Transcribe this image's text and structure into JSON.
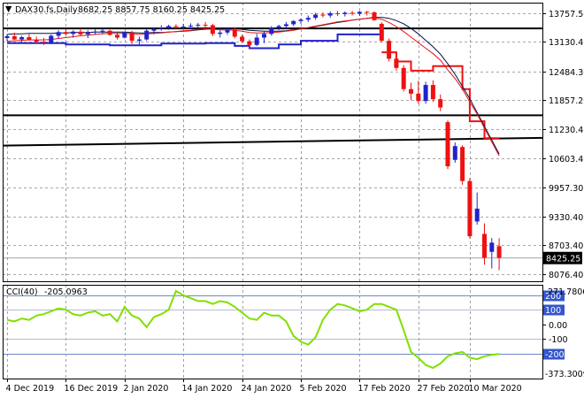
{
  "chart_data": [
    {
      "type": "candlestick",
      "symbol_line": "DAX30.fs,Daily",
      "ohlc_readout": "8682.25 8857.75 8160.25 8425.25",
      "last_price_label": "8425.25",
      "ylim": [
        7920,
        13980
      ],
      "price_ticks": [
        {
          "value": 13757.5,
          "label": "13757.50"
        },
        {
          "value": 13130.4,
          "label": "13130.40"
        },
        {
          "value": 12484.3,
          "label": "12484.30"
        },
        {
          "value": 11857.2,
          "label": "11857.20"
        },
        {
          "value": 11230.4,
          "label": "11230.40"
        },
        {
          "value": 10603.4,
          "label": "10603.40"
        },
        {
          "value": 9957.3,
          "label": "9957.30"
        },
        {
          "value": 9330.4,
          "label": "9330.40"
        },
        {
          "value": 8703.4,
          "label": "8703.40"
        },
        {
          "value": 8076.4,
          "label": "8076.40"
        }
      ],
      "horizontal_levels": [
        13420,
        11530,
        11020
      ],
      "candles": [
        {
          "o": 13210,
          "h": 13290,
          "l": 13140,
          "c": 13250
        },
        {
          "o": 13250,
          "h": 13330,
          "l": 13170,
          "c": 13180
        },
        {
          "o": 13180,
          "h": 13260,
          "l": 13100,
          "c": 13230
        },
        {
          "o": 13230,
          "h": 13300,
          "l": 13150,
          "c": 13170
        },
        {
          "o": 13170,
          "h": 13240,
          "l": 13090,
          "c": 13130
        },
        {
          "o": 13130,
          "h": 13210,
          "l": 13060,
          "c": 13110
        },
        {
          "o": 13110,
          "h": 13290,
          "l": 13080,
          "c": 13260
        },
        {
          "o": 13260,
          "h": 13380,
          "l": 13200,
          "c": 13340
        },
        {
          "o": 13340,
          "h": 13400,
          "l": 13270,
          "c": 13300
        },
        {
          "o": 13300,
          "h": 13380,
          "l": 13220,
          "c": 13350
        },
        {
          "o": 13350,
          "h": 13420,
          "l": 13250,
          "c": 13290
        },
        {
          "o": 13290,
          "h": 13380,
          "l": 13210,
          "c": 13330
        },
        {
          "o": 13330,
          "h": 13400,
          "l": 13280,
          "c": 13350
        },
        {
          "o": 13350,
          "h": 13410,
          "l": 13300,
          "c": 13370
        },
        {
          "o": 13370,
          "h": 13390,
          "l": 13260,
          "c": 13280
        },
        {
          "o": 13280,
          "h": 13340,
          "l": 13180,
          "c": 13220
        },
        {
          "o": 13220,
          "h": 13350,
          "l": 13200,
          "c": 13330
        },
        {
          "o": 13330,
          "h": 13370,
          "l": 13080,
          "c": 13150
        },
        {
          "o": 13150,
          "h": 13240,
          "l": 13060,
          "c": 13180
        },
        {
          "o": 13180,
          "h": 13400,
          "l": 13150,
          "c": 13370
        },
        {
          "o": 13370,
          "h": 13440,
          "l": 13290,
          "c": 13410
        },
        {
          "o": 13410,
          "h": 13490,
          "l": 13370,
          "c": 13440
        },
        {
          "o": 13440,
          "h": 13500,
          "l": 13390,
          "c": 13470
        },
        {
          "o": 13470,
          "h": 13510,
          "l": 13410,
          "c": 13450
        },
        {
          "o": 13450,
          "h": 13520,
          "l": 13400,
          "c": 13460
        },
        {
          "o": 13460,
          "h": 13530,
          "l": 13410,
          "c": 13480
        },
        {
          "o": 13480,
          "h": 13540,
          "l": 13430,
          "c": 13500
        },
        {
          "o": 13500,
          "h": 13560,
          "l": 13440,
          "c": 13490
        },
        {
          "o": 13490,
          "h": 13520,
          "l": 13250,
          "c": 13300
        },
        {
          "o": 13300,
          "h": 13380,
          "l": 13220,
          "c": 13330
        },
        {
          "o": 13330,
          "h": 13420,
          "l": 13280,
          "c": 13390
        },
        {
          "o": 13390,
          "h": 13440,
          "l": 13200,
          "c": 13240
        },
        {
          "o": 13240,
          "h": 13280,
          "l": 13100,
          "c": 13140
        },
        {
          "o": 13140,
          "h": 13180,
          "l": 12980,
          "c": 13060
        },
        {
          "o": 13060,
          "h": 13300,
          "l": 13040,
          "c": 13220
        },
        {
          "o": 13220,
          "h": 13360,
          "l": 13100,
          "c": 13300
        },
        {
          "o": 13300,
          "h": 13470,
          "l": 13260,
          "c": 13430
        },
        {
          "o": 13430,
          "h": 13500,
          "l": 13380,
          "c": 13470
        },
        {
          "o": 13470,
          "h": 13560,
          "l": 13420,
          "c": 13510
        },
        {
          "o": 13510,
          "h": 13600,
          "l": 13470,
          "c": 13580
        },
        {
          "o": 13580,
          "h": 13640,
          "l": 13520,
          "c": 13610
        },
        {
          "o": 13610,
          "h": 13700,
          "l": 13560,
          "c": 13650
        },
        {
          "o": 13650,
          "h": 13760,
          "l": 13610,
          "c": 13720
        },
        {
          "o": 13720,
          "h": 13770,
          "l": 13660,
          "c": 13700
        },
        {
          "o": 13700,
          "h": 13790,
          "l": 13650,
          "c": 13750
        },
        {
          "o": 13750,
          "h": 13800,
          "l": 13690,
          "c": 13730
        },
        {
          "o": 13730,
          "h": 13790,
          "l": 13680,
          "c": 13760
        },
        {
          "o": 13760,
          "h": 13800,
          "l": 13700,
          "c": 13740
        },
        {
          "o": 13740,
          "h": 13800,
          "l": 13690,
          "c": 13780
        },
        {
          "o": 13780,
          "h": 13800,
          "l": 13700,
          "c": 13770
        },
        {
          "o": 13770,
          "h": 13790,
          "l": 13580,
          "c": 13600
        },
        {
          "o": 13520,
          "h": 13550,
          "l": 13110,
          "c": 13150
        },
        {
          "o": 13150,
          "h": 13200,
          "l": 12700,
          "c": 12760
        },
        {
          "o": 12760,
          "h": 12860,
          "l": 12500,
          "c": 12560
        },
        {
          "o": 12560,
          "h": 12620,
          "l": 12050,
          "c": 12100
        },
        {
          "o": 12100,
          "h": 12240,
          "l": 11860,
          "c": 12000
        },
        {
          "o": 12000,
          "h": 12280,
          "l": 11780,
          "c": 11840
        },
        {
          "o": 11840,
          "h": 12260,
          "l": 11780,
          "c": 12190
        },
        {
          "o": 12190,
          "h": 12290,
          "l": 11820,
          "c": 11880
        },
        {
          "o": 11880,
          "h": 11980,
          "l": 11620,
          "c": 11700
        },
        {
          "o": 11380,
          "h": 11420,
          "l": 10360,
          "c": 10420
        },
        {
          "o": 10560,
          "h": 10940,
          "l": 10500,
          "c": 10860
        },
        {
          "o": 10840,
          "h": 10880,
          "l": 10020,
          "c": 10100
        },
        {
          "o": 10100,
          "h": 10160,
          "l": 8850,
          "c": 8900
        },
        {
          "o": 9220,
          "h": 9850,
          "l": 9150,
          "c": 9500
        },
        {
          "o": 8950,
          "h": 9180,
          "l": 8280,
          "c": 8420
        },
        {
          "o": 8560,
          "h": 8860,
          "l": 8200,
          "c": 8760
        },
        {
          "o": 8682.25,
          "h": 8857.75,
          "l": 8160.25,
          "c": 8425.25
        }
      ],
      "ma_red": [
        13140,
        13150,
        13160,
        13170,
        13170,
        13170,
        13180,
        13200,
        13220,
        13240,
        13260,
        13270,
        13290,
        13300,
        13310,
        13310,
        13310,
        13300,
        13290,
        13300,
        13310,
        13320,
        13340,
        13350,
        13370,
        13380,
        13400,
        13410,
        13400,
        13390,
        13390,
        13380,
        13360,
        13330,
        13320,
        13320,
        13330,
        13340,
        13360,
        13380,
        13410,
        13440,
        13470,
        13500,
        13530,
        13560,
        13580,
        13600,
        13620,
        13640,
        13650,
        13620,
        13550,
        13460,
        13350,
        13230,
        13110,
        12990,
        12870,
        12730,
        12520,
        12330,
        12100,
        11820,
        11560,
        11250,
        10950,
        10650
      ],
      "ma_black": [
        13290,
        13300,
        13300,
        13310,
        13310,
        13310,
        13310,
        13320,
        13320,
        13330,
        13330,
        13330,
        13340,
        13340,
        13340,
        13340,
        13340,
        13330,
        13320,
        13320,
        13330,
        13330,
        13340,
        13350,
        13360,
        13370,
        13390,
        13400,
        13410,
        13410,
        13410,
        13410,
        13400,
        13380,
        13370,
        13360,
        13360,
        13360,
        13370,
        13390,
        13410,
        13430,
        13460,
        13490,
        13520,
        13550,
        13570,
        13600,
        13620,
        13640,
        13660,
        13660,
        13640,
        13590,
        13520,
        13420,
        13300,
        13160,
        13020,
        12860,
        12650,
        12420,
        12160,
        11890,
        11590,
        11290,
        10990,
        10690
      ],
      "band_blue_step": [
        [
          0,
          13100
        ],
        [
          8,
          13100
        ],
        [
          8,
          13070
        ],
        [
          14,
          13070
        ],
        [
          14,
          13050
        ],
        [
          21,
          13050
        ],
        [
          21,
          13090
        ],
        [
          27,
          13090
        ],
        [
          27,
          13100
        ],
        [
          31,
          13100
        ],
        [
          31,
          13040
        ],
        [
          33,
          13040
        ],
        [
          33,
          12990
        ],
        [
          37,
          12990
        ],
        [
          37,
          13070
        ],
        [
          40,
          13070
        ],
        [
          40,
          13150
        ],
        [
          45,
          13150
        ],
        [
          45,
          13290
        ],
        [
          51,
          13290
        ]
      ],
      "band_red_step": [
        [
          51,
          12900
        ],
        [
          53,
          12900
        ],
        [
          53,
          12700
        ],
        [
          55,
          12700
        ],
        [
          55,
          12500
        ],
        [
          58,
          12500
        ],
        [
          58,
          12600
        ],
        [
          62,
          12600
        ],
        [
          62,
          12100
        ],
        [
          63,
          12100
        ],
        [
          63,
          11400
        ],
        [
          65,
          11400
        ],
        [
          65,
          11030
        ],
        [
          67,
          11030
        ]
      ],
      "cci_label": "CCI(40)",
      "cci_value": "-205.0963",
      "cci_ylim": [
        -373.3009,
        271.7806
      ],
      "cci_top_label": "271.7806",
      "cci_bottom_label": "-373.3009",
      "cci_ticks": [
        {
          "value": 200,
          "label": "200",
          "highlight": true
        },
        {
          "value": 100,
          "label": "100",
          "highlight": true
        },
        {
          "value": 0,
          "label": "0.00",
          "highlight": false
        },
        {
          "value": -100,
          "label": "-100",
          "highlight": false
        },
        {
          "value": -200,
          "label": "-200",
          "highlight": true
        }
      ],
      "cci_values": [
        30,
        20,
        40,
        30,
        60,
        70,
        90,
        110,
        100,
        70,
        60,
        80,
        90,
        60,
        70,
        20,
        120,
        60,
        40,
        -20,
        50,
        70,
        100,
        230,
        200,
        180,
        160,
        160,
        140,
        160,
        150,
        120,
        80,
        40,
        30,
        80,
        60,
        60,
        20,
        -80,
        -120,
        -140,
        -90,
        30,
        100,
        140,
        130,
        110,
        90,
        100,
        140,
        140,
        120,
        100,
        -40,
        -190,
        -230,
        -280,
        -300,
        -270,
        -220,
        -200,
        -190,
        -230,
        -240,
        -220,
        -210,
        -205
      ],
      "x_labels": [
        {
          "index": 0,
          "label": "4 Dec 2019"
        },
        {
          "index": 8,
          "label": "16 Dec 2019"
        },
        {
          "index": 16,
          "label": "2 Jan 2020"
        },
        {
          "index": 24,
          "label": "14 Jan 2020"
        },
        {
          "index": 32,
          "label": "24 Jan 2020"
        },
        {
          "index": 40,
          "label": "5 Feb 2020"
        },
        {
          "index": 48,
          "label": "17 Feb 2020"
        },
        {
          "index": 56,
          "label": "27 Feb 2020"
        },
        {
          "index": 63,
          "label": "10 Mar 2020"
        }
      ],
      "colors": {
        "up": "#2222cc",
        "down": "#ee1111",
        "cci_line": "#7fe000",
        "level_line": "#000000",
        "grid": "#8a8a8a",
        "cci_highlight_bg": "#3355cc",
        "cci_level_200": "#6f86cc",
        "cci_level_minus200": "#6f86cc"
      }
    }
  ]
}
